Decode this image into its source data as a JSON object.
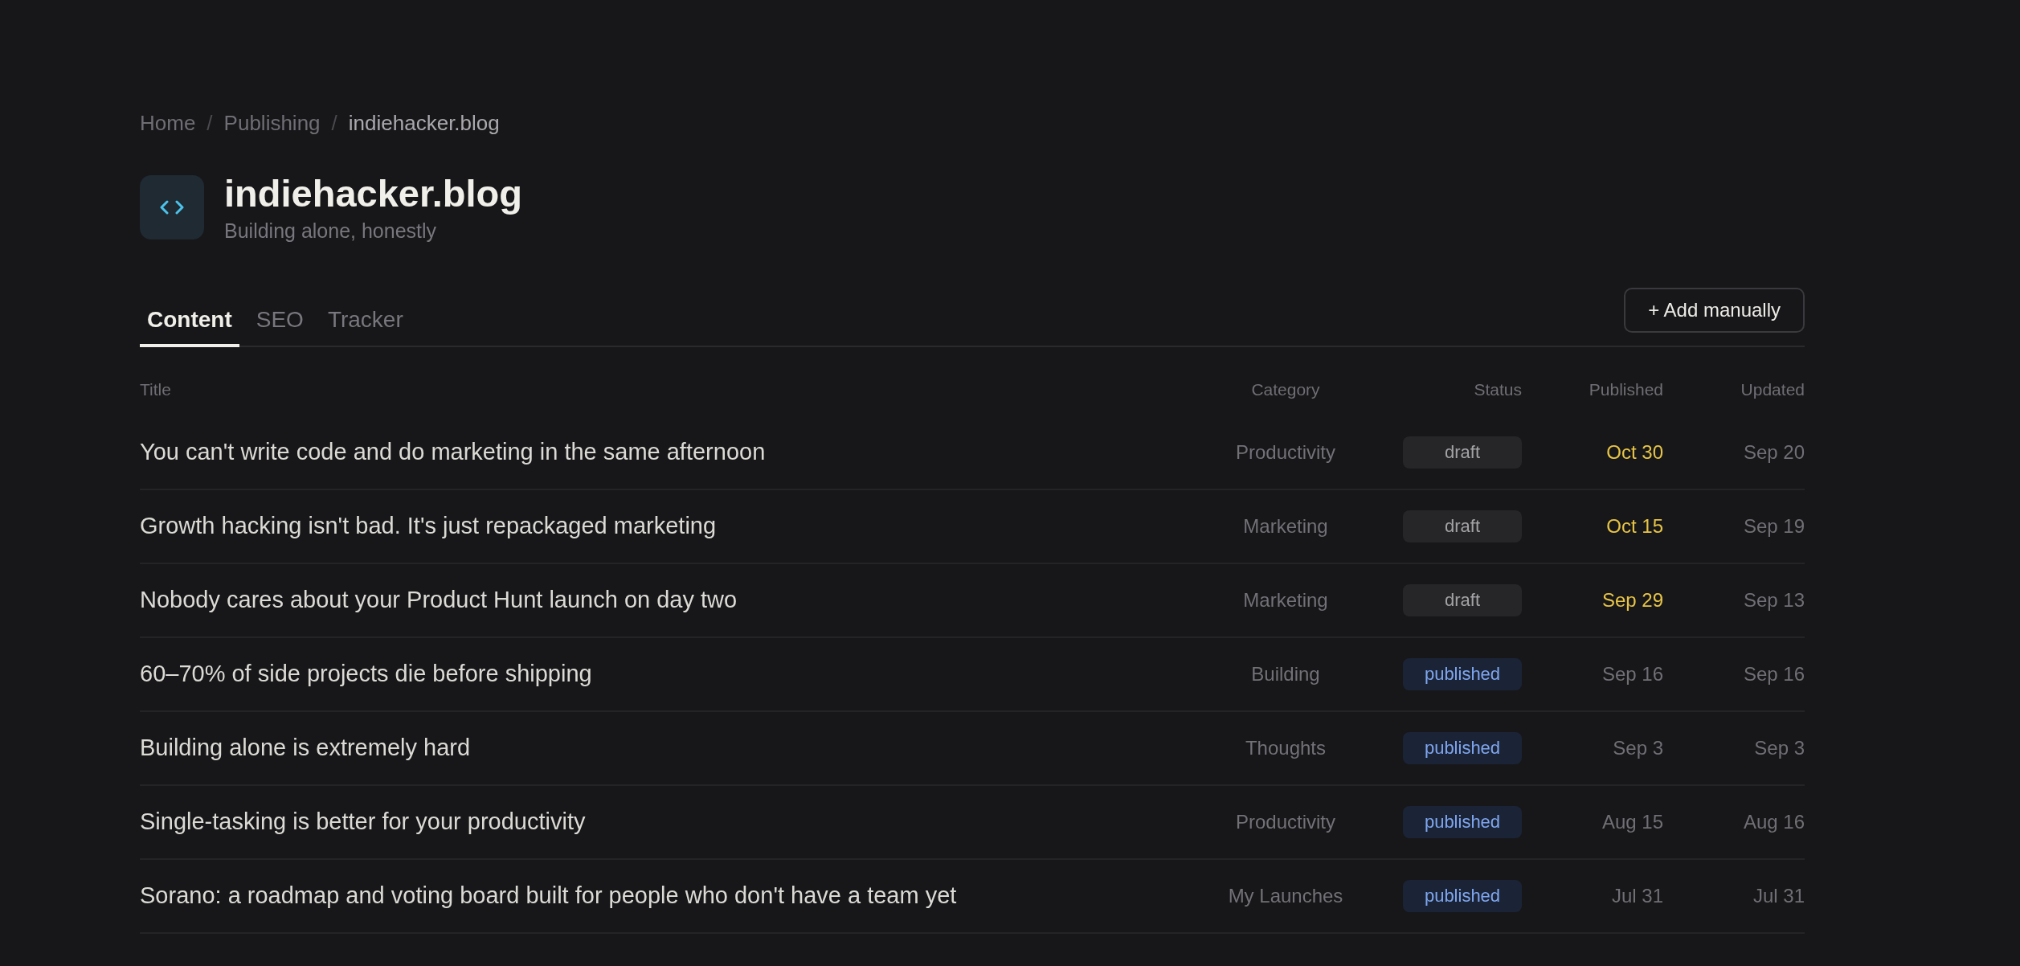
{
  "breadcrumb": [
    {
      "label": "Home",
      "current": false
    },
    {
      "label": "Publishing",
      "current": false
    },
    {
      "label": "indiehacker.blog",
      "current": true
    }
  ],
  "separator": "/",
  "site": {
    "title": "indiehacker.blog",
    "subtitle": "Building alone, honestly"
  },
  "tabs": [
    {
      "label": "Content",
      "selected": true
    },
    {
      "label": "SEO",
      "selected": false
    },
    {
      "label": "Tracker",
      "selected": false
    }
  ],
  "add_button": "+ Add manually",
  "table": {
    "columns": [
      "Title",
      "Category",
      "Status",
      "Published",
      "Updated"
    ],
    "rows": [
      {
        "title": "You can't write code and do marketing in the same afternoon",
        "category": "Productivity",
        "status": {
          "label": "draft",
          "kind": "draft"
        },
        "published": "Oct 30",
        "highlighted": true,
        "updated": "Sep 20"
      },
      {
        "title": "Growth hacking isn't bad. It's just repackaged marketing",
        "category": "Marketing",
        "status": {
          "label": "draft",
          "kind": "draft"
        },
        "published": "Oct 15",
        "highlighted": true,
        "updated": "Sep 19"
      },
      {
        "title": "Nobody cares about your Product Hunt launch on day two",
        "category": "Marketing",
        "status": {
          "label": "draft",
          "kind": "draft"
        },
        "published": "Sep 29",
        "highlighted": true,
        "updated": "Sep 13"
      },
      {
        "title": "60–70% of side projects die before shipping",
        "category": "Building",
        "status": {
          "label": "published",
          "kind": "published"
        },
        "published": "Sep 16",
        "highlighted": false,
        "updated": "Sep 16"
      },
      {
        "title": "Building alone is extremely hard",
        "category": "Thoughts",
        "status": {
          "label": "published",
          "kind": "published"
        },
        "published": "Sep 3",
        "highlighted": false,
        "updated": "Sep 3"
      },
      {
        "title": "Single-tasking is better for your productivity",
        "category": "Productivity",
        "status": {
          "label": "published",
          "kind": "published"
        },
        "published": "Aug 15",
        "highlighted": false,
        "updated": "Aug 16"
      },
      {
        "title": "Sorano: a roadmap and voting board built for people who don't have a team yet",
        "category": "My Launches",
        "status": {
          "label": "published",
          "kind": "published"
        },
        "published": "Jul 31",
        "highlighted": false,
        "updated": "Jul 31"
      }
    ]
  }
}
